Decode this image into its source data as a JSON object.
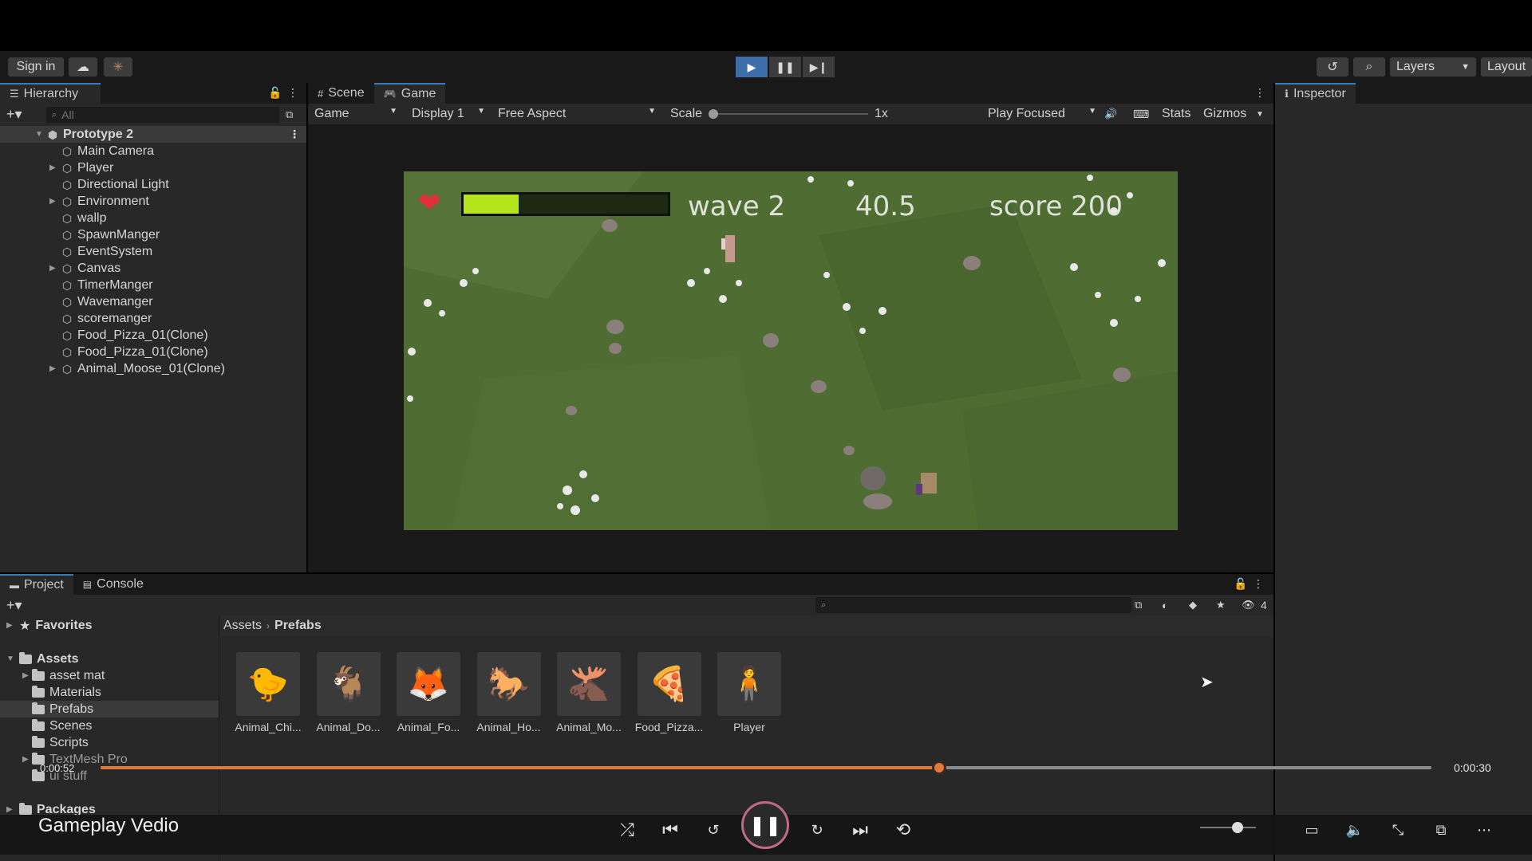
{
  "toolbar": {
    "sign_in": "Sign in",
    "layers": "Layers",
    "layout": "Layout"
  },
  "hierarchy": {
    "tab": "Hierarchy",
    "search_placeholder": "All",
    "root": "Prototype 2",
    "items": [
      {
        "label": "Main Camera",
        "expandable": false
      },
      {
        "label": "Player",
        "expandable": true
      },
      {
        "label": "Directional Light",
        "expandable": false
      },
      {
        "label": "Environment",
        "expandable": true
      },
      {
        "label": "wallp",
        "expandable": false
      },
      {
        "label": "SpawnManger",
        "expandable": false
      },
      {
        "label": "EventSystem",
        "expandable": false
      },
      {
        "label": "Canvas",
        "expandable": true
      },
      {
        "label": "TimerManger",
        "expandable": false
      },
      {
        "label": "Wavemanger",
        "expandable": false
      },
      {
        "label": "scoremanger",
        "expandable": false
      },
      {
        "label": "Food_Pizza_01(Clone)",
        "expandable": false
      },
      {
        "label": "Food_Pizza_01(Clone)",
        "expandable": false
      },
      {
        "label": "Animal_Moose_01(Clone)",
        "expandable": true
      }
    ]
  },
  "view": {
    "tab_scene": "Scene",
    "tab_game": "Game",
    "game_select": "Game",
    "display": "Display 1",
    "aspect": "Free Aspect",
    "scale_label": "Scale",
    "scale_value": "1x",
    "play_focused": "Play Focused",
    "stats": "Stats",
    "gizmos": "Gizmos"
  },
  "hud": {
    "health_fraction": 0.27,
    "wave": "wave 2",
    "timer": "40.5",
    "score": "score 200"
  },
  "inspector": {
    "tab": "Inspector"
  },
  "project": {
    "tab_project": "Project",
    "tab_console": "Console",
    "favorites": "Favorites",
    "assets": "Assets",
    "folders": [
      "asset mat",
      "Materials",
      "Prefabs",
      "Scenes",
      "Scripts",
      "TextMesh Pro",
      "ui stuff"
    ],
    "packages": "Packages",
    "breadcrumb_root": "Assets",
    "breadcrumb_current": "Prefabs",
    "hidden_count": "4",
    "prefabs": [
      "Animal_Chi...",
      "Animal_Do...",
      "Animal_Fo...",
      "Animal_Ho...",
      "Animal_Mo...",
      "Food_Pizza...",
      "Player"
    ]
  },
  "video": {
    "title": "Gameplay Vedio",
    "current_time": "0:00:52",
    "total_time": "0:00:30",
    "progress_fraction": 0.63,
    "accent": "#e07b39"
  }
}
